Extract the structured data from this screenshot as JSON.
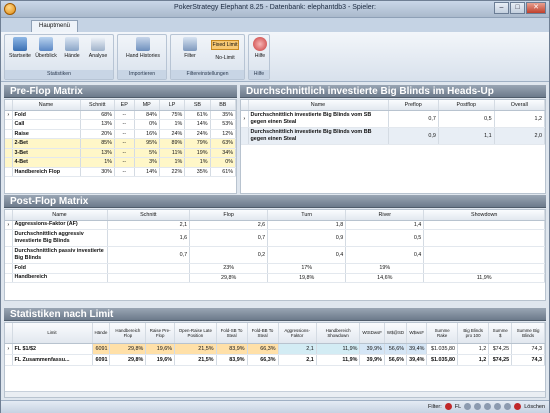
{
  "window": {
    "title": "PokerStrategy Elephant 8.25 - Datenbank: elephantdb3 - Spieler:",
    "min": "–",
    "max": "□",
    "close": "✕"
  },
  "tabs": [
    "Hauptmenü"
  ],
  "ribbon": {
    "groups": [
      {
        "caption": "Statistiken",
        "buttons": [
          "Startseite",
          "Überblick",
          "Hände",
          "Analyse"
        ]
      },
      {
        "caption": "Importieren",
        "buttons": [
          "Hand Histories"
        ]
      },
      {
        "caption": "Filtereinstellungen",
        "buttons": [
          "Filter"
        ],
        "fixed_limit": "Fixed Limit",
        "no_limit": "No-Limit"
      },
      {
        "caption": "Hilfe",
        "buttons": [
          "Hilfe"
        ]
      }
    ]
  },
  "preflop": {
    "title": "Pre-Flop Matrix",
    "headers": [
      "Name",
      "Schnitt",
      "EP",
      "MP",
      "LP",
      "SB",
      "BB"
    ],
    "rows": [
      [
        "Fold",
        "68%",
        "--",
        "84%",
        "75%",
        "61%",
        "35%"
      ],
      [
        "Call",
        "13%",
        "--",
        "0%",
        "1%",
        "14%",
        "53%"
      ],
      [
        "Raise",
        "20%",
        "--",
        "16%",
        "24%",
        "24%",
        "12%"
      ],
      [
        "2-Bet",
        "85%",
        "--",
        "95%",
        "89%",
        "79%",
        "63%"
      ],
      [
        "3-Bet",
        "13%",
        "--",
        "5%",
        "11%",
        "19%",
        "34%"
      ],
      [
        "4-Bet",
        "1%",
        "--",
        "3%",
        "1%",
        "1%",
        "0%"
      ],
      [
        "Handbereich Flop",
        "30%",
        "--",
        "14%",
        "22%",
        "35%",
        "61%"
      ]
    ]
  },
  "headsup": {
    "title": "Durchschnittlich investierte Big Blinds im Heads-Up",
    "headers": [
      "Name",
      "Preflop",
      "Postflop",
      "Overall"
    ],
    "rows": [
      [
        "Durchschnittlich investierte Big Blinds vom SB gegen einen Steal",
        "0,7",
        "0,5",
        "1,2"
      ],
      [
        "Durchschnittlich investierte Big Blinds vom BB gegen einen Steal",
        "0,9",
        "1,1",
        "2,0"
      ]
    ]
  },
  "postflop": {
    "title": "Post-Flop Matrix",
    "headers": [
      "Name",
      "Schnitt",
      "Flop",
      "Turn",
      "River",
      "Showdown"
    ],
    "rows": [
      [
        "Aggressions-Faktor (AF)",
        "2,1",
        "2,6",
        "1,8",
        "1,4",
        ""
      ],
      [
        "Durchschnittlich aggressiv investierte Big Blinds",
        "1,6",
        "0,7",
        "0,9",
        "0,5",
        ""
      ],
      [
        "Durchschnittlich passiv investierte Big Blinds",
        "0,7",
        "0,2",
        "0,4",
        "0,4",
        ""
      ],
      [
        "Fold",
        "",
        "23%",
        "17%",
        "19%",
        ""
      ],
      [
        "Handbereich",
        "",
        "29,8%",
        "19,8%",
        "14,6%",
        "11,9%"
      ]
    ]
  },
  "limit": {
    "title": "Statistiken nach Limit",
    "headers": [
      "Limit",
      "Hände",
      "Handbereich Flop",
      "Raise Pre-Flop",
      "Open-Raise Late Position",
      "Fold-SB To Steal",
      "Fold-BB To Steal",
      "Aggressions-Faktor",
      "Handbereich Showdown",
      "WtSDwsF",
      "W$@SD",
      "W$wsF",
      "Summe Rake",
      "Big Blinds pro 100",
      "Summe $",
      "Summe Big Blinds"
    ],
    "rows": [
      [
        "FL $1/$2",
        "6091",
        "29,8%",
        "19,6%",
        "21,5%",
        "83,9%",
        "66,3%",
        "2,1",
        "11,9%",
        "39,9%",
        "56,6%",
        "39,4%",
        "$1.035,80",
        "1,2",
        "$74,25",
        "74,3"
      ],
      [
        "FL Zusammenfassu...",
        "6091",
        "29,8%",
        "19,6%",
        "21,5%",
        "83,9%",
        "66,3%",
        "2,1",
        "11,9%",
        "39,9%",
        "56,6%",
        "39,4%",
        "$1.035,80",
        "1,2",
        "$74,25",
        "74,3"
      ]
    ]
  },
  "status": {
    "filter_label": "Filter:",
    "fl": "FL",
    "delete": "Löschen"
  }
}
